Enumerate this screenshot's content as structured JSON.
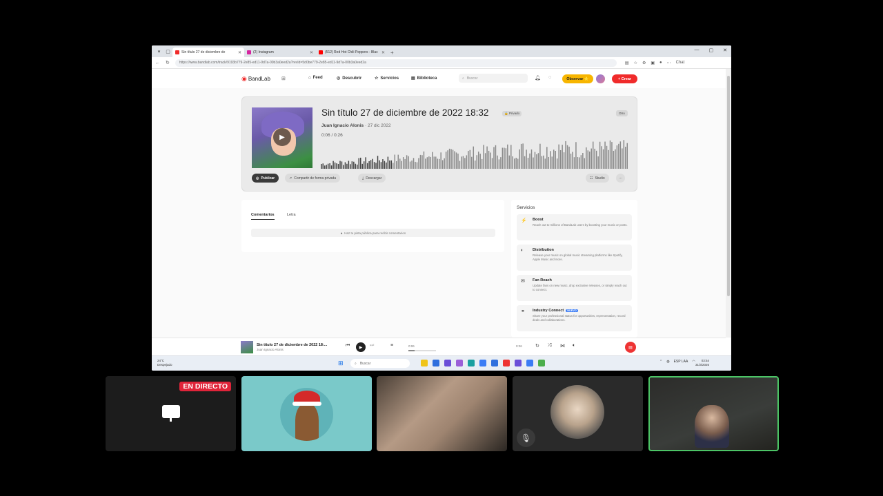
{
  "browser": {
    "tabs": [
      {
        "label": "Sin título 27 de diciembre de",
        "color": "#f02b2b",
        "active": true
      },
      {
        "label": "(2) Instagram",
        "color": "#d6249f",
        "active": false
      },
      {
        "label": "(512) Red Hot Chili Peppers - Blac",
        "color": "#ff0000",
        "active": false
      }
    ],
    "url": "https://www.bandlab.com/track/9193b779-2e85-ed11-9d7a-00b3a0eed2a?revId=5d0be779-2e85-ed11-9d7a-00b3a0eed2a",
    "window_controls": [
      "—",
      "▢",
      "✕"
    ],
    "chat_label": "Chat"
  },
  "bandlab_nav": {
    "logo": "BandLab",
    "items": [
      {
        "label": "Feed",
        "icon": "home-icon"
      },
      {
        "label": "Descubrir",
        "icon": "compass-icon"
      },
      {
        "label": "Servicios",
        "icon": "star-icon"
      },
      {
        "label": "Biblioteca",
        "icon": "library-icon"
      }
    ],
    "search_placeholder": "Buscar",
    "observar": "Observar ⭐",
    "crear": "+ Crear"
  },
  "track": {
    "title": "Sin título 27 de diciembre de 2022 18:32",
    "privacy": "🔒 Privado",
    "genre": "Otro",
    "artist": "Juan Ignacio Alonis",
    "date": "· 27 dic 2022",
    "time": "0:06 / 0:26",
    "progress": 0.23,
    "buttons": {
      "publish": "Publicar",
      "share": "Compartir de forma privada",
      "download": "Descargar",
      "studio": "Studio",
      "more": "···"
    }
  },
  "comments": {
    "tabs": [
      "Comentarios",
      "Letra"
    ],
    "notice": "Haz tu pista pública para recibir comentarios"
  },
  "services": {
    "heading": "Servicios",
    "items": [
      {
        "title": "Boost",
        "badge": "",
        "icon": "⚡",
        "desc": "Reach out to millions of BandLab users by boosting your music or posts."
      },
      {
        "title": "Distribution",
        "badge": "",
        "icon": "◐",
        "desc": "Release your music on global music streaming platforms like Spotify, Apple Music and more."
      },
      {
        "title": "Fan Reach",
        "badge": "",
        "icon": "✉",
        "desc": "Update fans on new music, drop exclusive releases, or simply reach out to connect."
      },
      {
        "title": "Industry Connect",
        "badge": "NUEVO",
        "icon": "⚭",
        "desc": "Share your professional status for opportunities, representation, record deals and collaborations."
      }
    ]
  },
  "player": {
    "title": "Sin título 27 de diciembre de 2022 18:...",
    "artist": "Juan Ignacio Alonis",
    "time_left": "0:06",
    "time_right": "0:26",
    "progress": 0.23
  },
  "taskbar": {
    "weather_temp": "24°C",
    "weather_desc": "Despejado",
    "search": "Buscar",
    "lang": "ESP LAA",
    "time": "03:54",
    "date": "31/3/2026",
    "app_colors": [
      "#f0c419",
      "#2f6fde",
      "#6b4fd8",
      "#9c5fd8",
      "#1aa0a0",
      "#3b7cf5",
      "#2f6fde",
      "#e33",
      "#6b4fd8",
      "#3b7cf5",
      "#4cae4c"
    ]
  },
  "call": {
    "live_label": "EN DIRECTO",
    "tiles": [
      "screen-share",
      "santa-avatar",
      "camera-1",
      "profile-photo",
      "camera-2"
    ]
  }
}
